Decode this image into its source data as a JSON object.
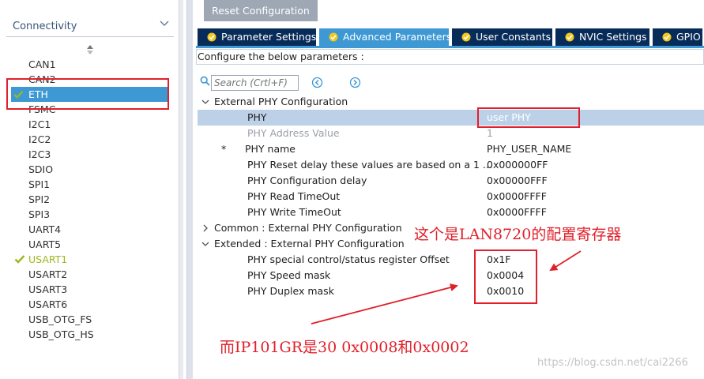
{
  "sidebar": {
    "category_title": "Connectivity",
    "items": [
      {
        "label": "CAN1",
        "state": "normal"
      },
      {
        "label": "CAN2",
        "state": "normal"
      },
      {
        "label": "ETH",
        "state": "selected"
      },
      {
        "label": "FSMC",
        "state": "normal"
      },
      {
        "label": "I2C1",
        "state": "normal"
      },
      {
        "label": "I2C2",
        "state": "normal"
      },
      {
        "label": "I2C3",
        "state": "normal"
      },
      {
        "label": "SDIO",
        "state": "normal"
      },
      {
        "label": "SPI1",
        "state": "normal"
      },
      {
        "label": "SPI2",
        "state": "normal"
      },
      {
        "label": "SPI3",
        "state": "normal"
      },
      {
        "label": "UART4",
        "state": "normal"
      },
      {
        "label": "UART5",
        "state": "normal"
      },
      {
        "label": "USART1",
        "state": "configured"
      },
      {
        "label": "USART2",
        "state": "normal"
      },
      {
        "label": "USART3",
        "state": "normal"
      },
      {
        "label": "USART6",
        "state": "normal"
      },
      {
        "label": "USB_OTG_FS",
        "state": "normal"
      },
      {
        "label": "USB_OTG_HS",
        "state": "normal"
      }
    ]
  },
  "toolbar": {
    "reset_label": "Reset Configuration"
  },
  "tabs": [
    {
      "label": "Parameter Settings",
      "active": false
    },
    {
      "label": "Advanced Parameters",
      "active": true
    },
    {
      "label": "User Constants",
      "active": false
    },
    {
      "label": "NVIC Settings",
      "active": false
    },
    {
      "label": "GPIO Settings",
      "active": false
    }
  ],
  "configure_text": "Configure the below parameters :",
  "search": {
    "placeholder": "Search (Crtl+F)"
  },
  "groups": {
    "external": "External PHY Configuration",
    "common": "Common : External PHY Configuration",
    "extended": "Extended : External PHY Configuration"
  },
  "params": {
    "phy": {
      "name": "PHY",
      "value": "user PHY"
    },
    "phy_address": {
      "name": "PHY Address Value",
      "value": "1"
    },
    "phy_name": {
      "star": "*",
      "name": "PHY name",
      "value": "PHY_USER_NAME"
    },
    "reset_delay": {
      "name": "PHY Reset delay these values are based on a 1 ...",
      "value": "0x000000FF"
    },
    "config_delay": {
      "name": "PHY Configuration delay",
      "value": "0x00000FFF"
    },
    "read_timeout": {
      "name": "PHY Read TimeOut",
      "value": "0x0000FFFF"
    },
    "write_timeout": {
      "name": "PHY Write TimeOut",
      "value": "0x0000FFFF"
    },
    "special_offset": {
      "name": "PHY special control/status register Offset",
      "value": "0x1F"
    },
    "speed_mask": {
      "name": "PHY Speed mask",
      "value": "0x0004"
    },
    "duplex_mask": {
      "name": "PHY Duplex mask",
      "value": "0x0010"
    }
  },
  "annotations": {
    "lan8720": "这个是LAN8720的配置寄存器",
    "ip101gr": "而IP101GR是30 0x0008和0x0002"
  },
  "watermark": "https://blog.csdn.net/cai2266",
  "colors": {
    "tab_dark": "#082c59",
    "tab_active": "#3d98d3",
    "configured_green": "#9bb820",
    "annotation_red": "#e0202a"
  }
}
